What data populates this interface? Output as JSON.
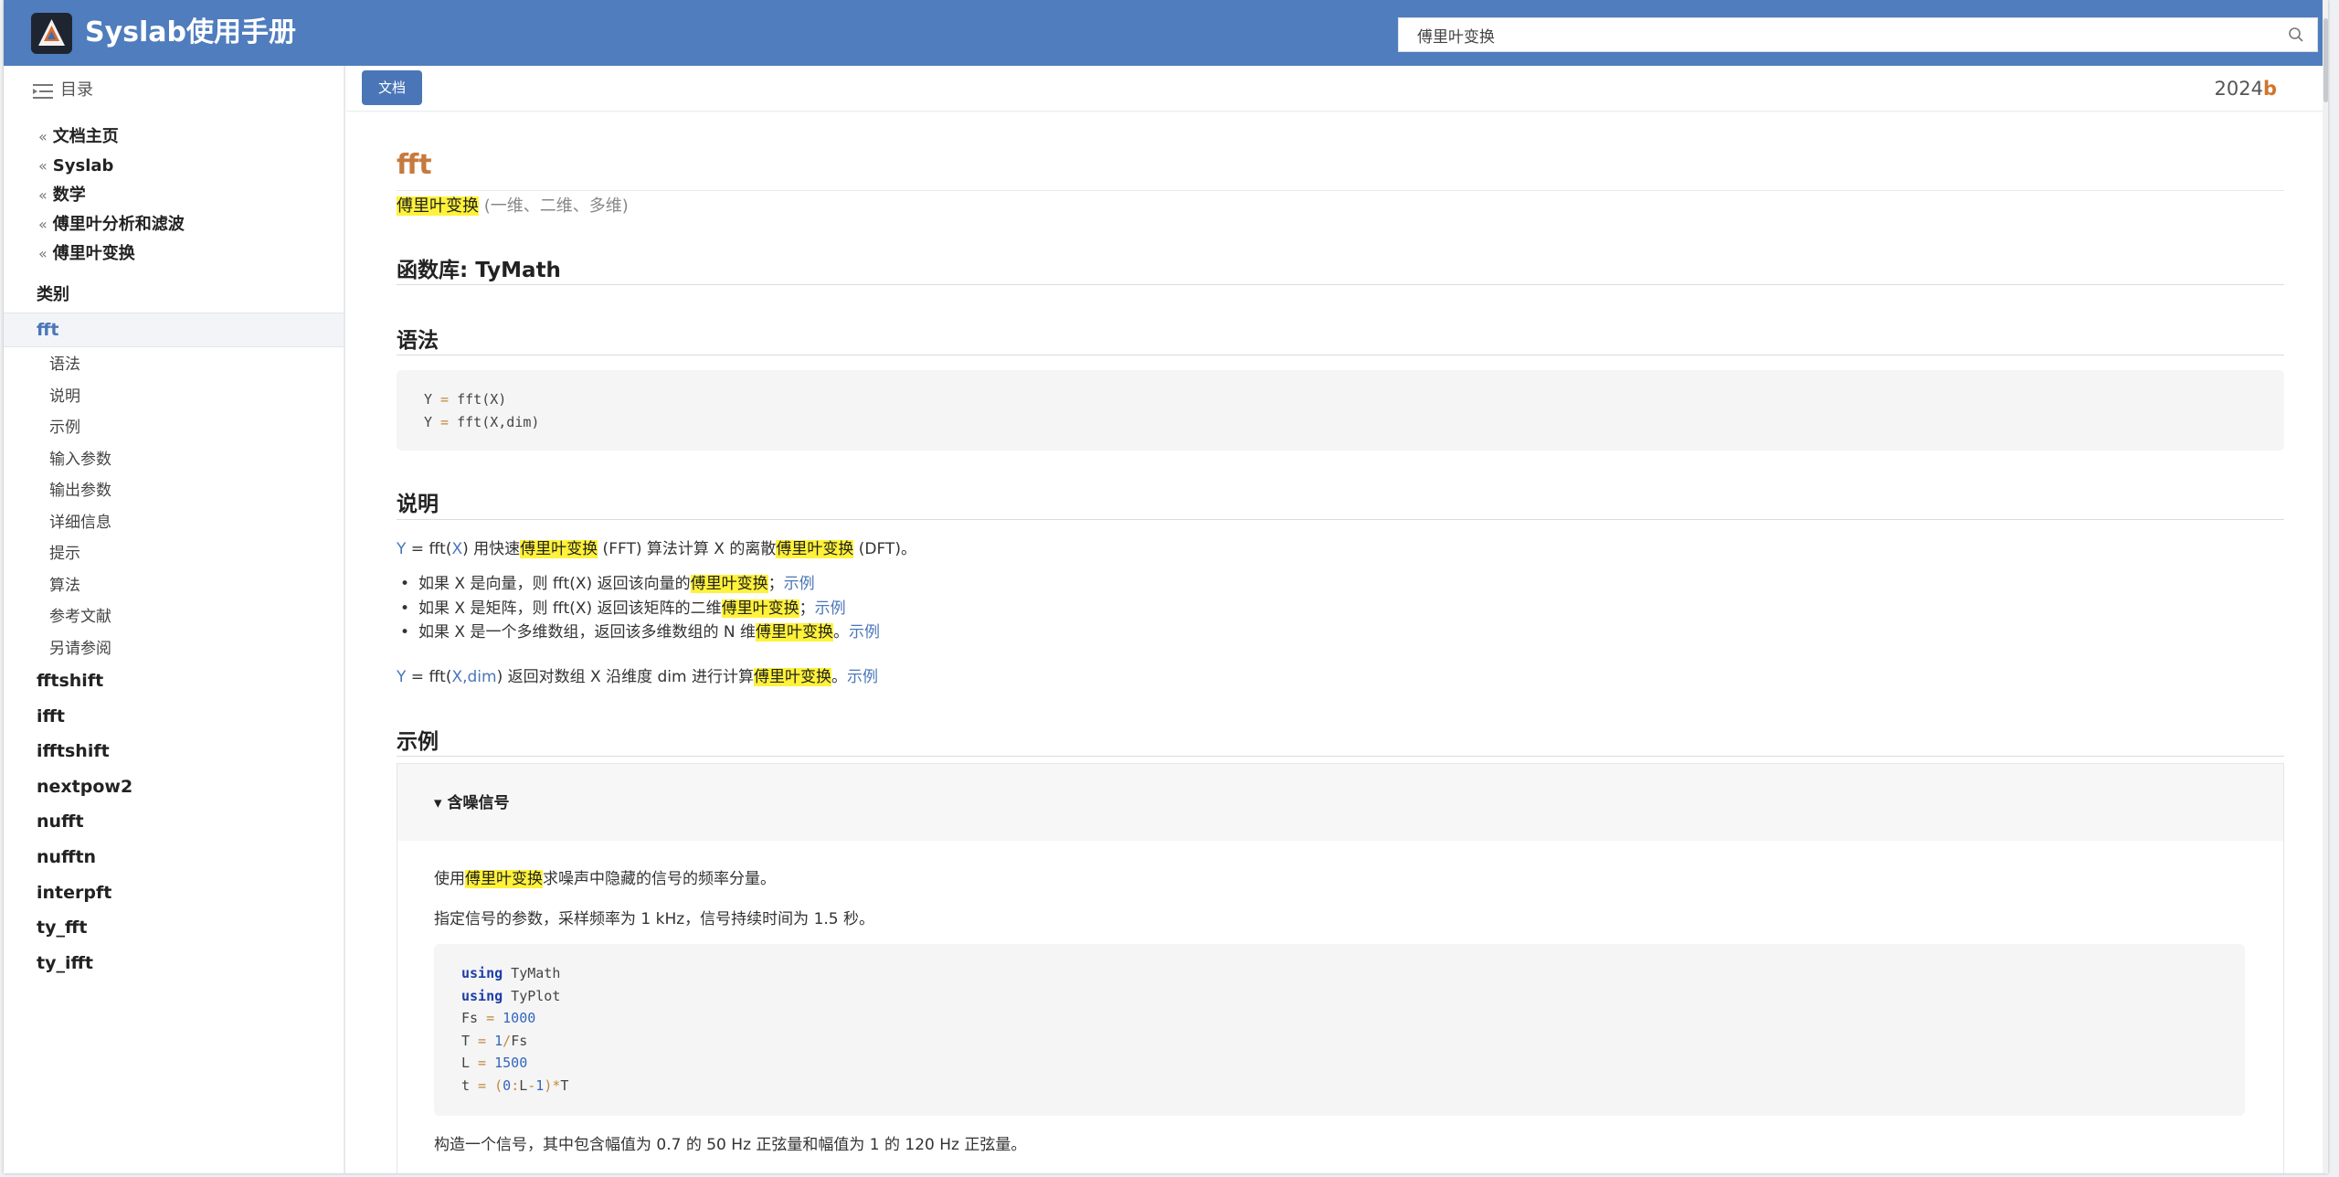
{
  "app": {
    "title": "Syslab使用手册"
  },
  "search": {
    "value": "傅里叶变换"
  },
  "toc": {
    "label": "目录"
  },
  "breadcrumbs": [
    "文档主页",
    "Syslab",
    "数学",
    "傅里叶分析和滤波",
    "傅里叶变换"
  ],
  "category": {
    "label": "类别"
  },
  "active": {
    "label": "fft"
  },
  "sub_items": [
    "语法",
    "说明",
    "示例",
    "输入参数",
    "输出参数",
    "详细信息",
    "提示",
    "算法",
    "参考文献",
    "另请参阅"
  ],
  "functions": [
    "fftshift",
    "ifft",
    "ifftshift",
    "nextpow2",
    "nufft",
    "nufftn",
    "interpft",
    "ty_fft",
    "ty_ifft"
  ],
  "toolbar": {
    "doc_button": "文档",
    "version_num": "2024",
    "version_letter": "b"
  },
  "page": {
    "title": "fft",
    "subtitle_hl": "傅里叶变换",
    "subtitle_rest": " (一维、二维、多维)",
    "library": "函数库: TyMath",
    "syntax_title": "语法",
    "desc_title": "说明",
    "examples_title": "示例"
  },
  "syntax": {
    "line1": {
      "lhs": "Y",
      "eq": " = ",
      "rest": "fft(X)"
    },
    "line2": {
      "lhs": "Y",
      "eq": " = ",
      "rest": "fft(X,dim)"
    }
  },
  "description": {
    "p1": {
      "y": "Y",
      "eq": " = fft(",
      "x": "X",
      "a": ") 用快速",
      "hl1": "傅里叶变换",
      "b": " (FFT) 算法计算 X 的离散",
      "hl2": "傅里叶变换",
      "c": " (DFT)。"
    },
    "bullets": [
      {
        "a": "如果 X 是向量，则 fft(X) 返回该向量的",
        "hl": "傅里叶变换",
        "b": "；",
        "link": "示例"
      },
      {
        "a": "如果 X 是矩阵，则 fft(X) 返回该矩阵的二维",
        "hl": "傅里叶变换",
        "b": "；",
        "link": "示例"
      },
      {
        "a": "如果 X 是一个多维数组，返回该多维数组的 N 维",
        "hl": "傅里叶变换",
        "b": "。",
        "link": "示例"
      }
    ],
    "p2": {
      "y": "Y",
      "eq": " = fft(",
      "xdim": "X,dim",
      "a": ") 返回对数组 X 沿维度 dim 进行计算",
      "hl": "傅里叶变换",
      "b": "。",
      "link": "示例"
    }
  },
  "example": {
    "heading": "▾ 含噪信号",
    "p1": {
      "a": "使用",
      "hl": "傅里叶变换",
      "b": "求噪声中隐藏的信号的频率分量。"
    },
    "p2": "指定信号的参数，采样频率为 1 kHz，信号持续时间为 1.5 秒。",
    "code": [
      {
        "kw": "using",
        "rest": " TyMath"
      },
      {
        "kw": "using",
        "rest": " TyPlot"
      },
      {
        "name": "Fs",
        "op": " = ",
        "val": "1000"
      },
      {
        "name": "T",
        "op": " = ",
        "val": "1",
        "op2": "/",
        "tail": "Fs"
      },
      {
        "name": "L",
        "op": " = ",
        "val": "1500"
      },
      {
        "name": "t",
        "op": " = ",
        "p1": "(",
        "val": "0",
        "op2": ":",
        "mid": "L",
        "op3": "-",
        "val2": "1",
        "p2": ")",
        "op4": "*",
        "tail": "T"
      }
    ],
    "p3": "构造一个信号，其中包含幅值为 0.7 的 50 Hz 正弦量和幅值为 1 的 120 Hz 正弦量。"
  }
}
